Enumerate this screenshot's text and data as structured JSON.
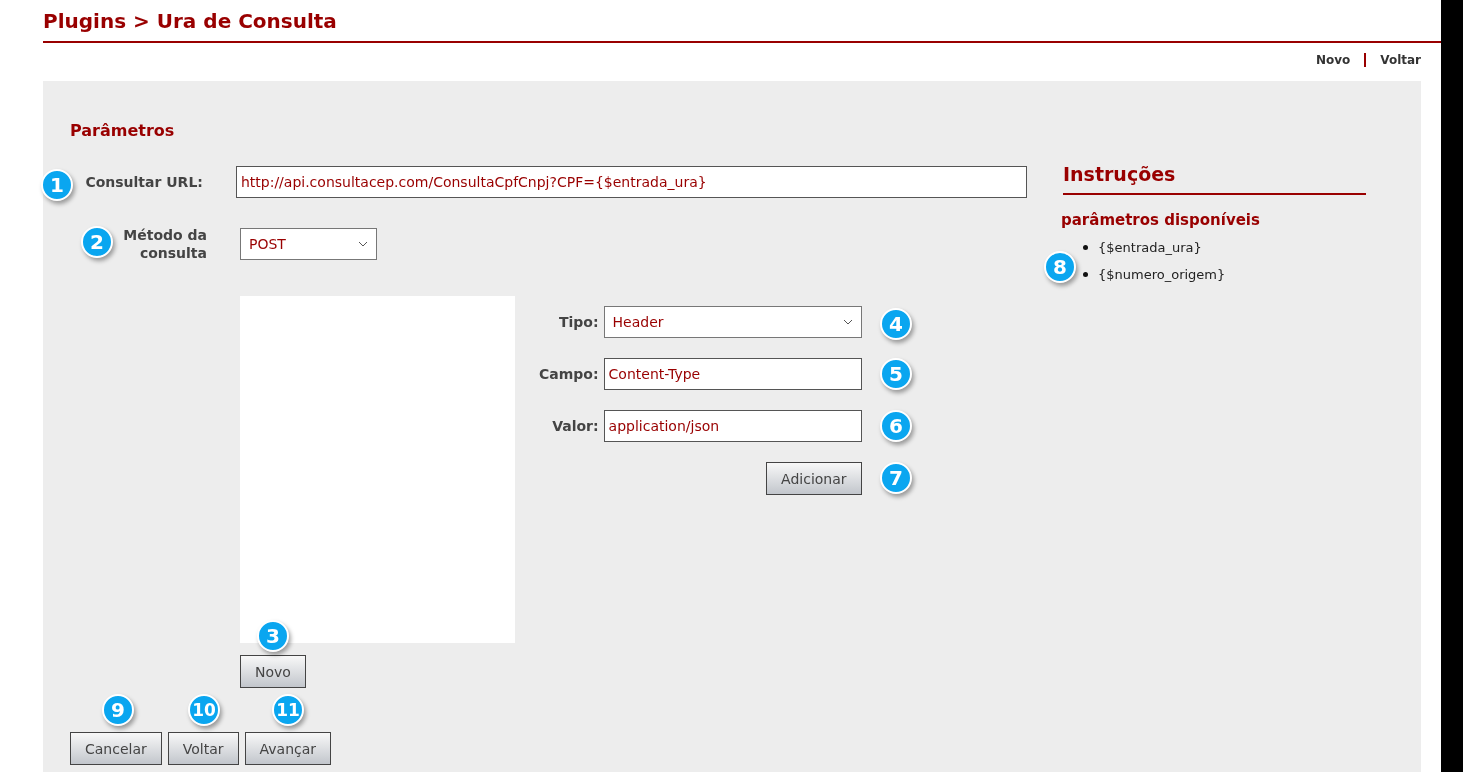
{
  "title": "Plugins > Ura de Consulta",
  "top_links": [
    "Novo",
    "Voltar"
  ],
  "section_title": "Parâmetros",
  "url_field": {
    "label": "Consultar URL:",
    "value": "http://api.consultacep.com/ConsultaCpfCnpj?CPF={$entrada_ura}"
  },
  "method_field": {
    "label": "Método da consulta",
    "value": "POST"
  },
  "header_form": {
    "tipo": {
      "label": "Tipo:",
      "value": "Header"
    },
    "campo": {
      "label": "Campo:",
      "value": "Content-Type"
    },
    "valor": {
      "label": "Valor:",
      "value": "application/json"
    },
    "add_button": "Adicionar"
  },
  "list_button": "Novo",
  "instructions": {
    "title": "Instruções",
    "subtitle": "parâmetros disponíveis",
    "items": [
      "{$entrada_ura}",
      "{$numero_origem}"
    ]
  },
  "footer_buttons": [
    "Cancelar",
    "Voltar",
    "Avançar"
  ],
  "callouts": [
    "1",
    "2",
    "3",
    "4",
    "5",
    "6",
    "7",
    "8",
    "9",
    "10",
    "11"
  ]
}
